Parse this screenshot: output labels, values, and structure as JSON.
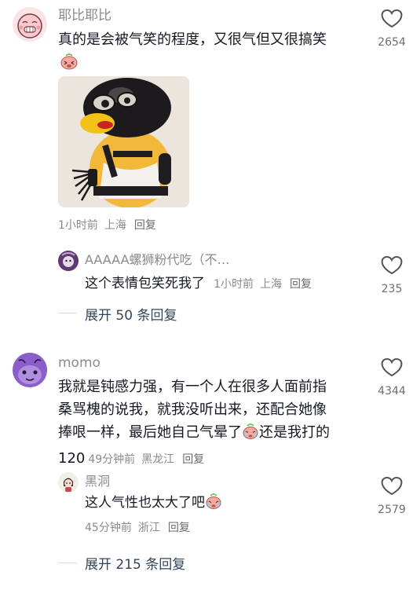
{
  "comments": [
    {
      "username": "耶比耶比",
      "text": "真的是会被气笑的程度，又很气但又很搞笑",
      "time": "1小时前",
      "location": "上海",
      "reply_label": "回复",
      "likes": "2654",
      "replies": [
        {
          "username": "AAAAA螺狮粉代吃（不…",
          "text": "这个表情包笑死我了",
          "time": "1小时前",
          "location": "上海",
          "reply_label": "回复",
          "likes": "235"
        }
      ],
      "expand_label": "展开 50 条回复"
    },
    {
      "username": "momo",
      "text_lines": [
        "我就是钝感力强，有一个人在很多人面前指",
        "桑骂槐的说我，就我没听出来，还配合她像",
        "捧哏一样，最后她自己气晕了",
        "还是我打的",
        "120"
      ],
      "time": "49分钟前",
      "location": "黑龙江",
      "reply_label": "回复",
      "likes": "4344",
      "replies": [
        {
          "username": "黑洞",
          "text": "这人气性也太大了吧",
          "time": "45分钟前",
          "location": "浙江",
          "reply_label": "回复",
          "likes": "2579"
        }
      ],
      "expand_label": "展开 215 条回复"
    }
  ],
  "colors": {
    "text": "#161823",
    "muted": "#8a8a8f",
    "expand": "#33445c"
  }
}
